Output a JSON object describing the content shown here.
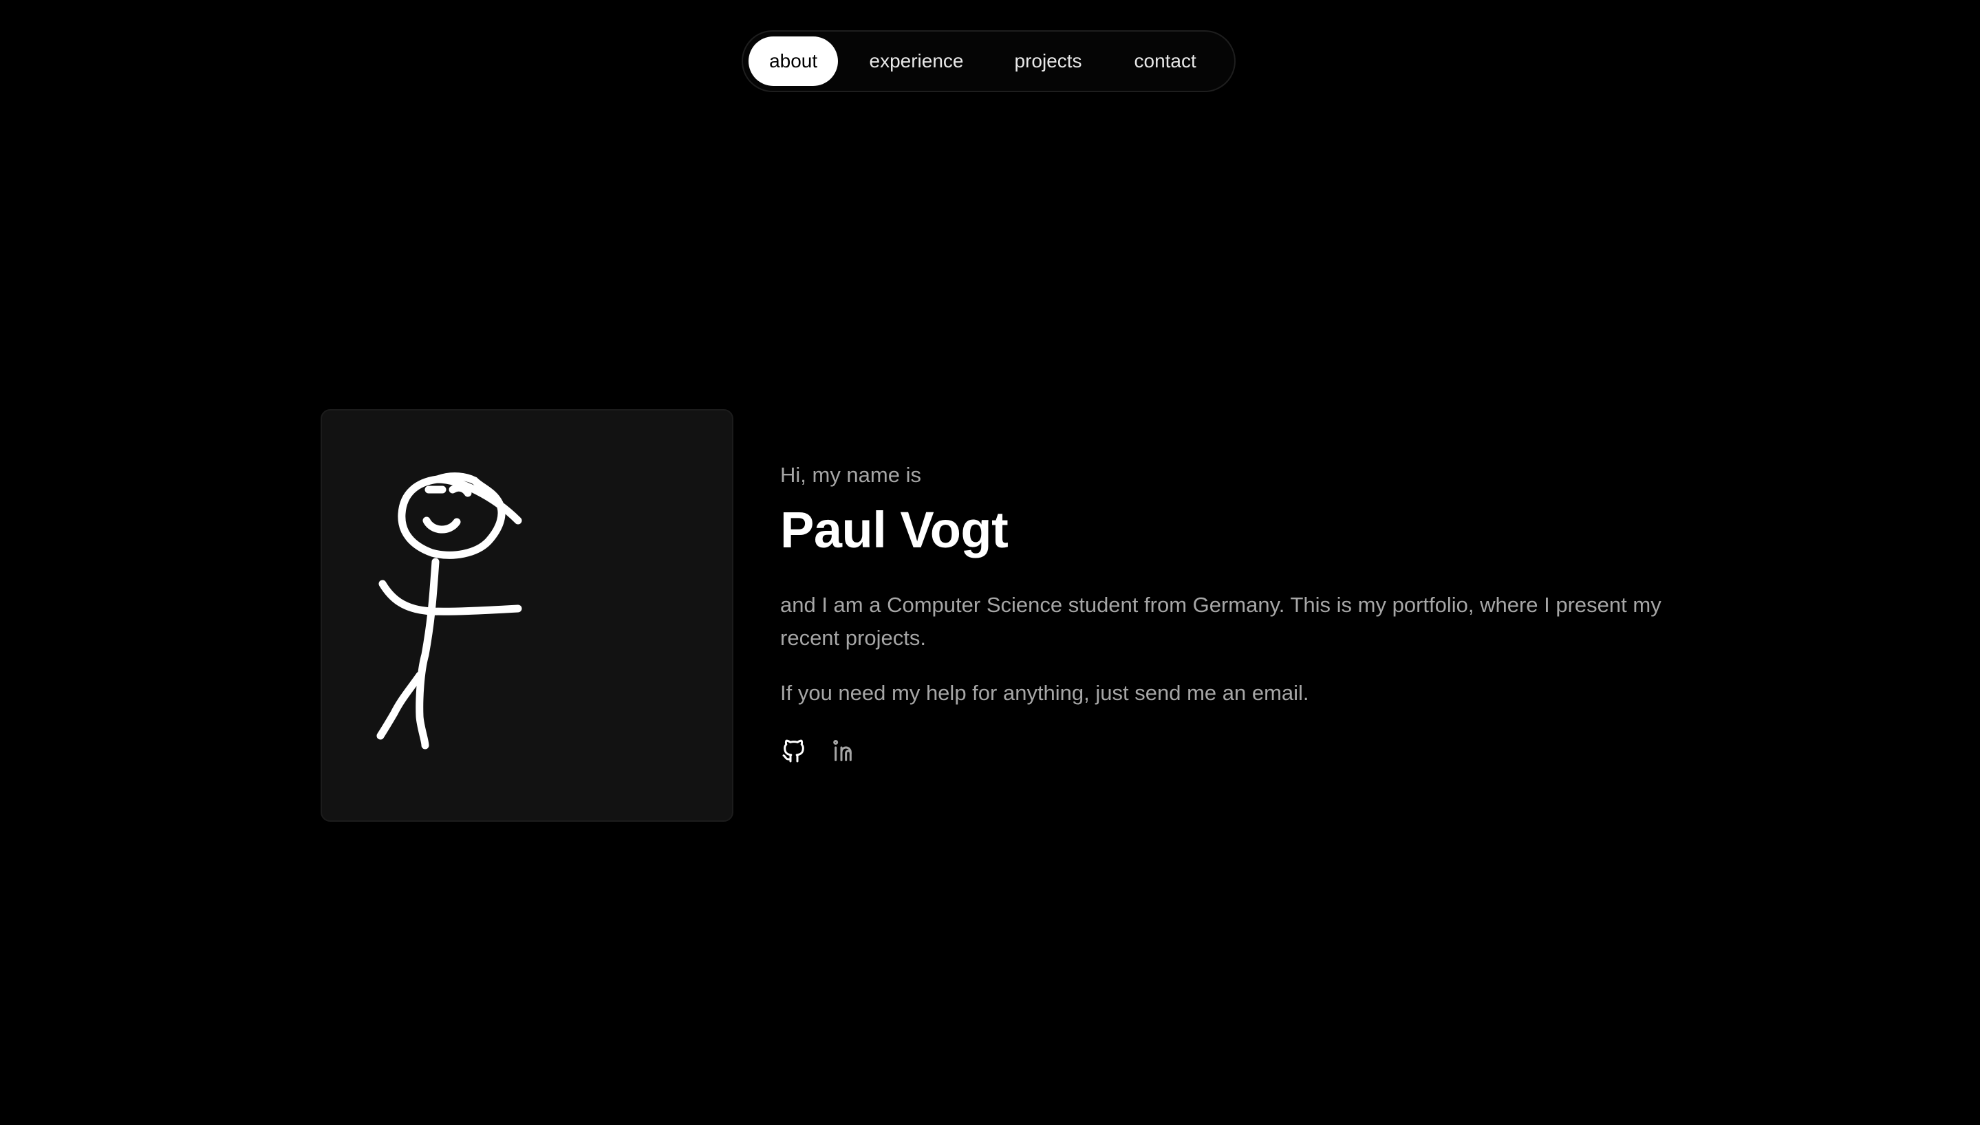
{
  "nav": {
    "items": [
      {
        "label": "about",
        "active": true
      },
      {
        "label": "experience",
        "active": false
      },
      {
        "label": "projects",
        "active": false
      },
      {
        "label": "contact",
        "active": false
      }
    ]
  },
  "hero": {
    "greeting": "Hi, my name is",
    "name": "Paul Vogt",
    "bio": "and I am a Computer Science student from Germany. This is my portfolio, where I present my recent projects.",
    "cta": "If you need my help for anything, just send me an email."
  },
  "avatar": {
    "icon": "stick-figure-drawing"
  },
  "socials": [
    {
      "icon": "github-icon"
    },
    {
      "icon": "linkedin-icon"
    }
  ],
  "colors": {
    "background": "#000000",
    "card": "#121212",
    "text_primary": "#ffffff",
    "text_secondary": "#a6a6a6",
    "nav_active_bg": "#ffffff"
  }
}
